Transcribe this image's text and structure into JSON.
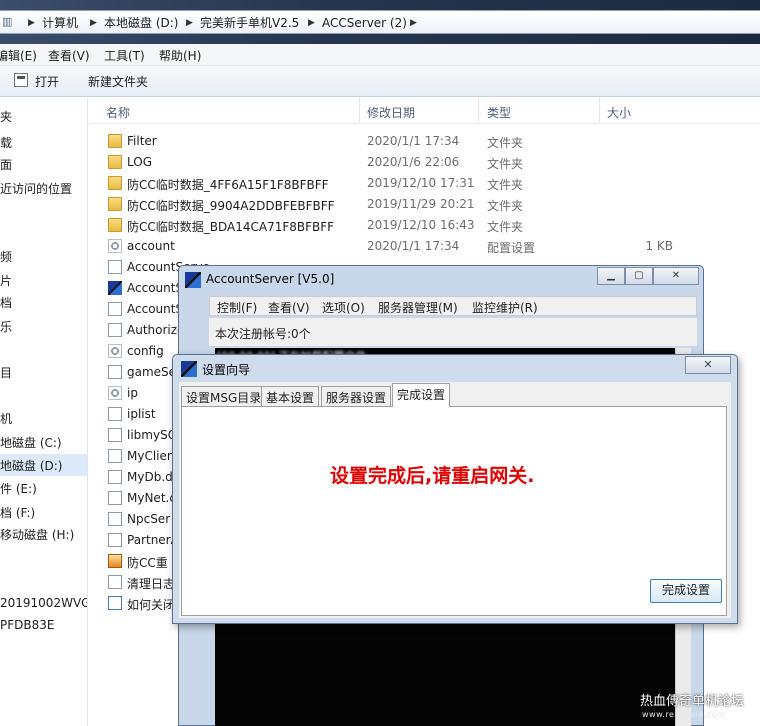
{
  "breadcrumb": [
    "计算机",
    "本地磁盘 (D:)",
    "完美新手单机V2.5",
    "ACCServer (2)"
  ],
  "menubar": [
    "编辑(E)",
    "查看(V)",
    "工具(T)",
    "帮助(H)"
  ],
  "toolbar": {
    "open_label": "打开",
    "new_folder_label": "新建文件夹"
  },
  "navpane": [
    "夹",
    "载",
    "面",
    "近访问的位置",
    "频",
    "片",
    "档",
    "乐",
    "目",
    "机",
    "地磁盘 (C:)",
    "地磁盘 (D:)",
    "件 (E:)",
    "档 (F:)",
    "移动磁盘 (H:)",
    "20191002WVG",
    "PFDB83E"
  ],
  "columns": {
    "name": "名称",
    "date": "修改日期",
    "type": "类型",
    "size": "大小"
  },
  "files": [
    {
      "name": "Filter",
      "date": "2020/1/1 17:34",
      "type": "文件夹",
      "size": "",
      "icon": "folder-icon"
    },
    {
      "name": "LOG",
      "date": "2020/1/6 22:06",
      "type": "文件夹",
      "size": "",
      "icon": "folder-icon"
    },
    {
      "name": "防CC临时数据_4FF6A15F1F8BFBFF",
      "date": "2019/12/10 17:31",
      "type": "文件夹",
      "size": "",
      "icon": "folder-icon"
    },
    {
      "name": "防CC临时数据_9904A2DDBFEBFBFF",
      "date": "2019/11/29 20:21",
      "type": "文件夹",
      "size": "",
      "icon": "folder-icon"
    },
    {
      "name": "防CC临时数据_BDA14CA71F8BFBFF",
      "date": "2019/12/10 16:43",
      "type": "文件夹",
      "size": "",
      "icon": "folder-icon"
    },
    {
      "name": "account",
      "date": "2020/1/1 17:34",
      "type": "配置设置",
      "size": "1 KB",
      "icon": "settings-file-icon"
    },
    {
      "name": "AccountServe",
      "date": "",
      "type": "",
      "size": "",
      "icon": "file-icon"
    },
    {
      "name": "AccountServer",
      "date": "",
      "type": "",
      "size": "",
      "icon": "app-icon"
    },
    {
      "name": "AccountServer",
      "date": "",
      "type": "",
      "size": "",
      "icon": "file-icon"
    },
    {
      "name": "AuthorizeDb.",
      "date": "",
      "type": "",
      "size": "",
      "icon": "file-icon"
    },
    {
      "name": "config",
      "date": "",
      "type": "",
      "size": "",
      "icon": "settings-file-icon"
    },
    {
      "name": "gameSe",
      "date": "",
      "type": "",
      "size": "",
      "icon": "file-icon"
    },
    {
      "name": "ip",
      "date": "",
      "type": "",
      "size": "",
      "icon": "settings-file-icon"
    },
    {
      "name": "iplist",
      "date": "",
      "type": "",
      "size": "",
      "icon": "file-icon"
    },
    {
      "name": "libmySQ",
      "date": "",
      "type": "",
      "size": "",
      "icon": "file-icon"
    },
    {
      "name": "MyClien",
      "date": "",
      "type": "",
      "size": "",
      "icon": "file-icon"
    },
    {
      "name": "MyDb.d",
      "date": "",
      "type": "",
      "size": "",
      "icon": "file-icon"
    },
    {
      "name": "MyNet.c",
      "date": "",
      "type": "",
      "size": "",
      "icon": "file-icon"
    },
    {
      "name": "NpcSer",
      "date": "",
      "type": "",
      "size": "",
      "icon": "file-icon"
    },
    {
      "name": "PartnerA",
      "date": "",
      "type": "",
      "size": "",
      "icon": "file-icon"
    },
    {
      "name": "防CC重",
      "date": "",
      "type": "",
      "size": "",
      "icon": "batch-icon"
    },
    {
      "name": "清理日志",
      "date": "",
      "type": "",
      "size": "",
      "icon": "file-icon"
    },
    {
      "name": "如何关闭",
      "date": "",
      "type": "",
      "size": "",
      "icon": "document-icon"
    }
  ],
  "account_server": {
    "title": "AccountServer [V5.0]",
    "menu": [
      "控制(F)",
      "查看(V)",
      "选项(O)",
      "服务器管理(M)",
      "监控维护(R)"
    ],
    "status": "本次注册帐号:0个",
    "log_line": "[00:00:00] 正在加载配置文件"
  },
  "wizard": {
    "title": "设置向导",
    "tabs": [
      "设置MSG目录",
      "基本设置",
      "服务器设置",
      "完成设置"
    ],
    "message": "设置完成后,请重启网关.",
    "finish_label": "完成设置"
  },
  "watermark": {
    "line1": "热血傳奇单机论坛",
    "line2": "www.rexuexia.com"
  }
}
